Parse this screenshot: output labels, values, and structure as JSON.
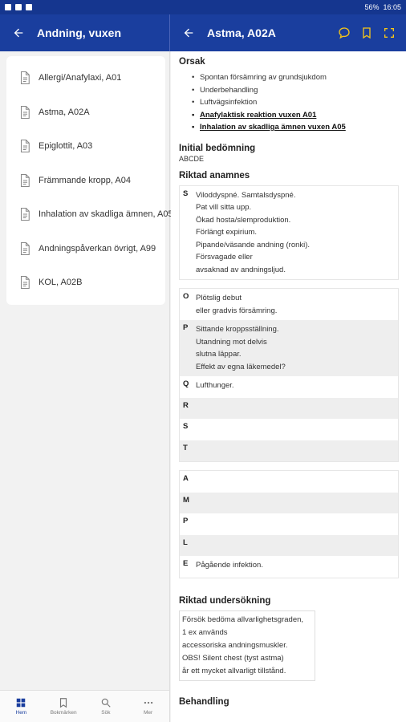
{
  "status": {
    "battery": "56%",
    "time": "16:05"
  },
  "left_header": {
    "title": "Andning, vuxen"
  },
  "right_header": {
    "title": "Astma, A02A"
  },
  "list": [
    "Allergi/Anafylaxi, A01",
    "Astma, A02A",
    "Epiglottit, A03",
    "Främmande kropp, A04",
    "Inhalation av skadliga ämnen, A05",
    "Andningspåverkan övrigt, A99",
    "KOL, A02B"
  ],
  "nav": [
    "Hem",
    "Bokmärken",
    "Sök",
    "Mer"
  ],
  "content": {
    "orsak_title": "Orsak",
    "orsak": [
      "Spontan försämring av grundsjukdom",
      "Underbehandling",
      "Luftvägsinfektion",
      "Anafylaktisk reaktion vuxen A01",
      "Inhalation av skadliga ämnen vuxen A05"
    ],
    "initial_title": "Initial bedömning",
    "initial_value": "ABCDE",
    "anamnes_title": "Riktad anamnes",
    "samplers": [
      {
        "k": "S",
        "v": "Viloddyspné. Samtalsdyspné.\nPat vill sitta upp.\nÖkad hosta/slemproduktion.\nFörlängt expirium.\nPipande/väsande andning (ronki).\nFörsvagade eller\navsaknad av andningsljud."
      }
    ],
    "opqrst": [
      {
        "k": "O",
        "v": "Plötslig debut\neller gradvis försämring."
      },
      {
        "k": "P",
        "v": "Sittande kroppsställning.\nUtandning mot delvis\nslutna läppar.\nEffekt av egna läkemedel?"
      },
      {
        "k": "Q",
        "v": "Lufthunger."
      },
      {
        "k": "R",
        "v": ""
      },
      {
        "k": "S",
        "v": ""
      },
      {
        "k": "T",
        "v": ""
      }
    ],
    "ample": [
      {
        "k": "A",
        "v": ""
      },
      {
        "k": "M",
        "v": ""
      },
      {
        "k": "P",
        "v": ""
      },
      {
        "k": "L",
        "v": ""
      },
      {
        "k": "E",
        "v": "Pågående infektion."
      }
    ],
    "exam_title": "Riktad undersökning",
    "exam": "Försök bedöma allvarlighetsgraden,\n1 ex används\naccessoriska andningsmuskler.\nOBS! Silent chest (tyst astma)\når ett mycket allvarligt tillstånd.",
    "treat_title": "Behandling"
  }
}
